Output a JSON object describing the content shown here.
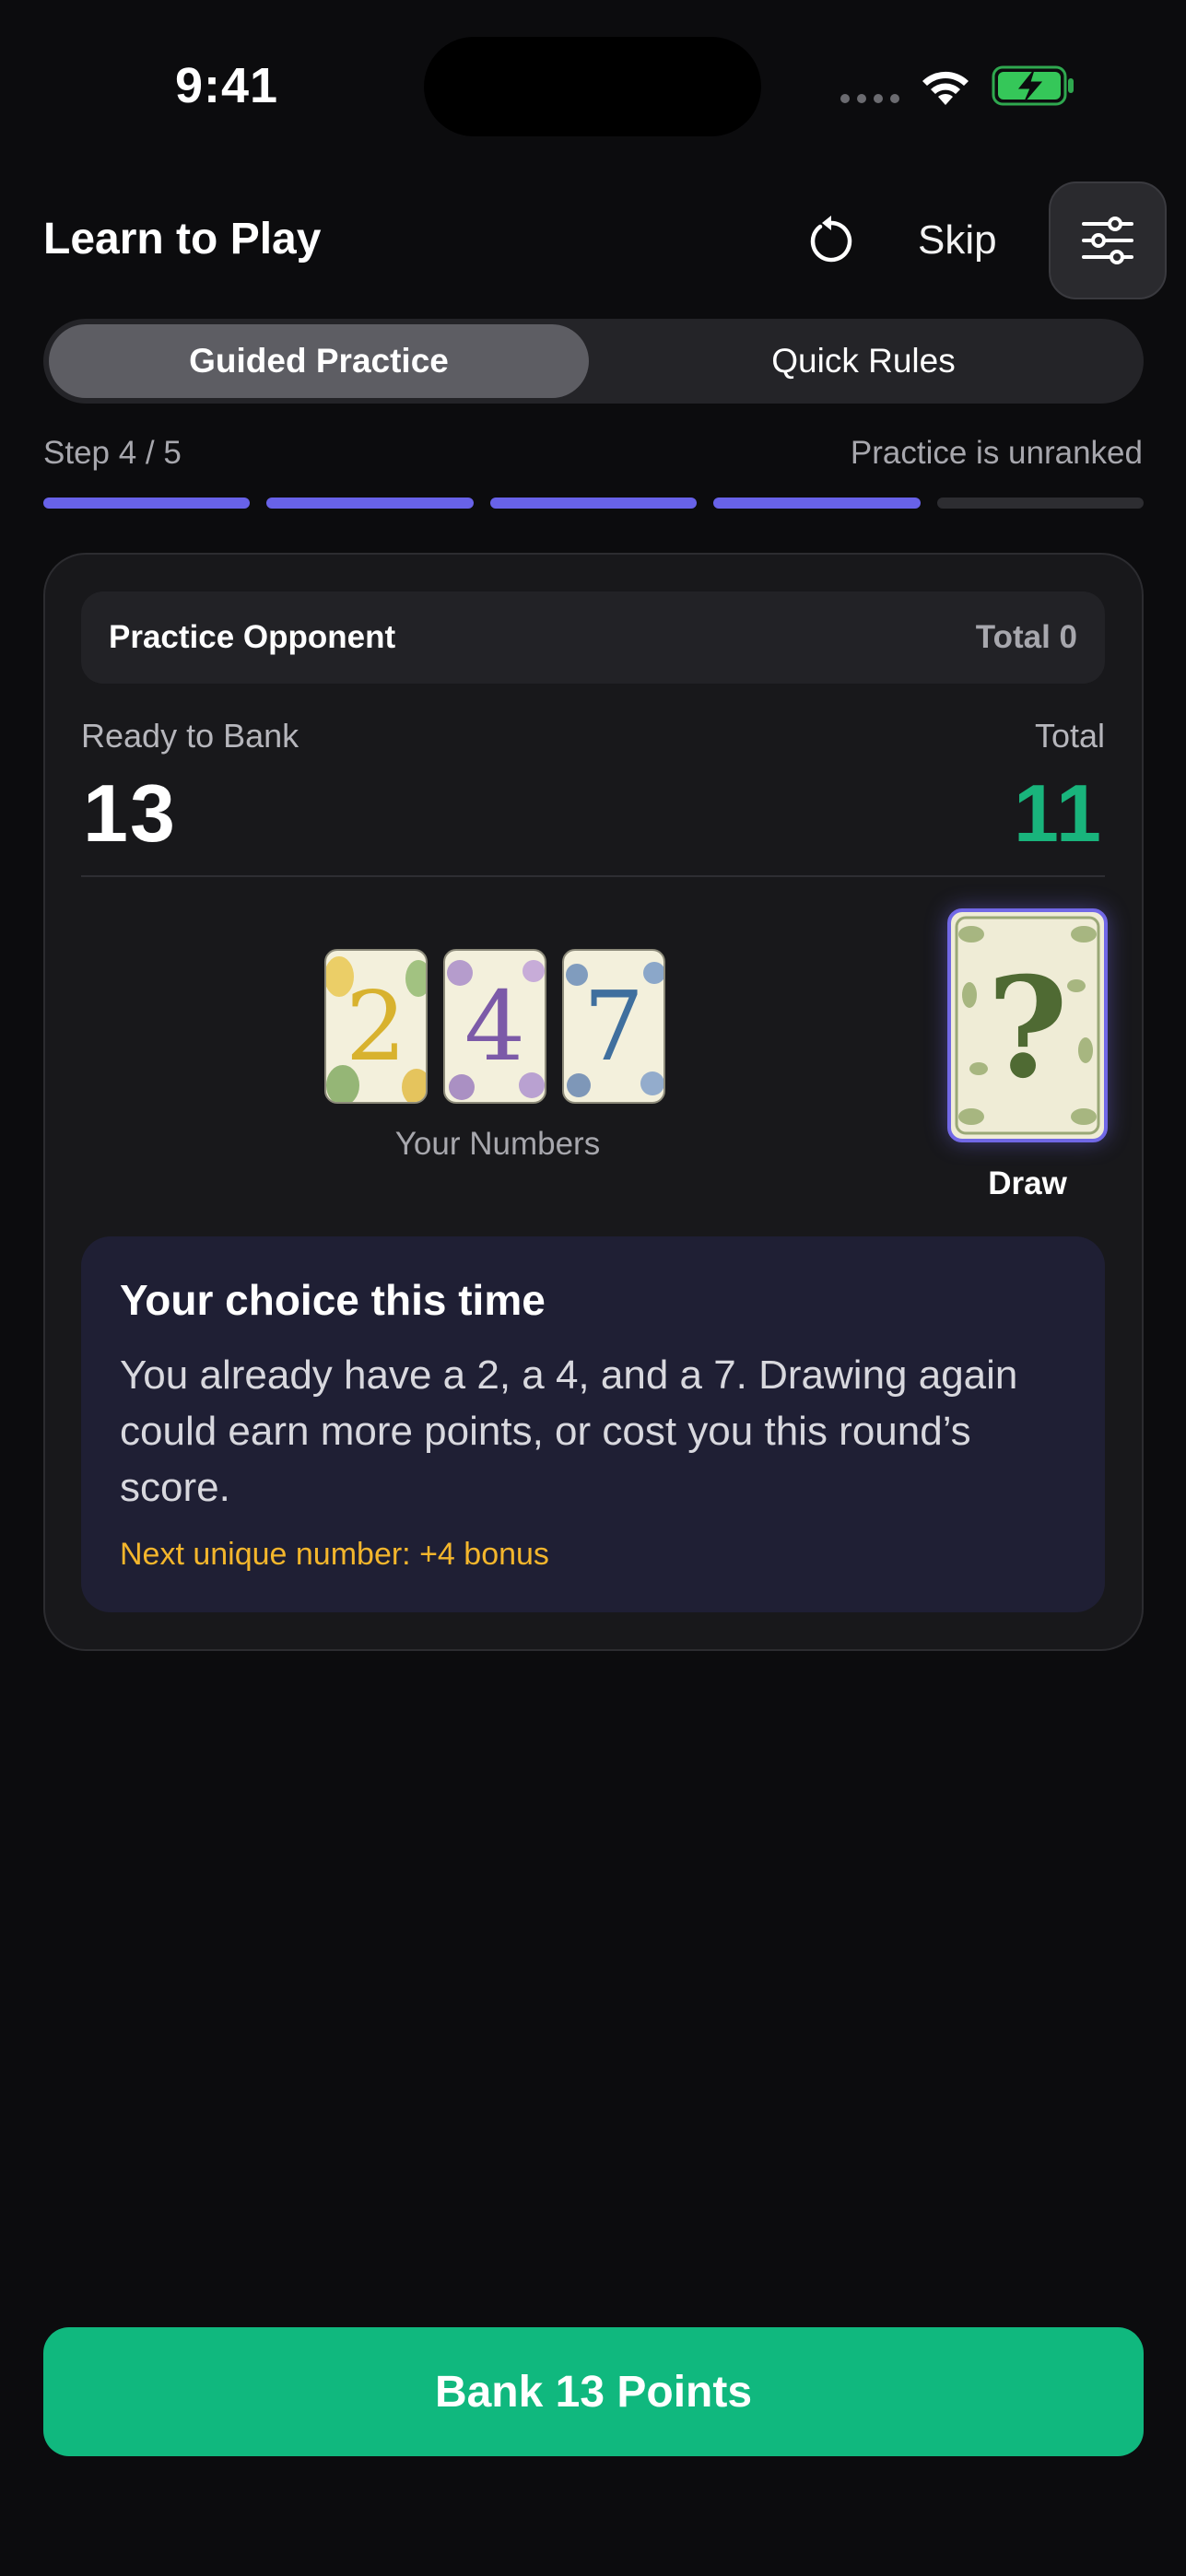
{
  "status_bar": {
    "time": "9:41"
  },
  "header": {
    "title": "Learn to Play",
    "skip_label": "Skip",
    "reset_icon": "reset-icon",
    "settings_icon": "sliders-icon"
  },
  "tabs": [
    {
      "label": "Guided Practice",
      "active": true
    },
    {
      "label": "Quick Rules",
      "active": false
    }
  ],
  "step": {
    "label": "Step 4 / 5",
    "current": 4,
    "total": 5,
    "note": "Practice is unranked"
  },
  "opponent": {
    "name": "Practice Opponent",
    "total_label": "Total 0"
  },
  "score": {
    "ready_label": "Ready to Bank",
    "ready_value": "13",
    "total_label": "Total",
    "total_value": "11"
  },
  "hand": {
    "cards": [
      "2",
      "4",
      "7"
    ],
    "caption": "Your Numbers"
  },
  "draw": {
    "label": "Draw",
    "symbol": "?"
  },
  "choice": {
    "title": "Your choice this time",
    "body": "You already have a 2, a 4, and a 7. Drawing again could earn more points, or cost you this round’s score.",
    "bonus": "Next unique number: +4 bonus"
  },
  "bank_button": {
    "label": "Bank 13 Points"
  },
  "colors": {
    "accent_purple": "#6862e8",
    "accent_green": "#10b87e",
    "bonus_yellow": "#f4b62c",
    "card_2": "#d8b22e",
    "card_4": "#7c5aa8",
    "card_7": "#3f6f9e"
  }
}
